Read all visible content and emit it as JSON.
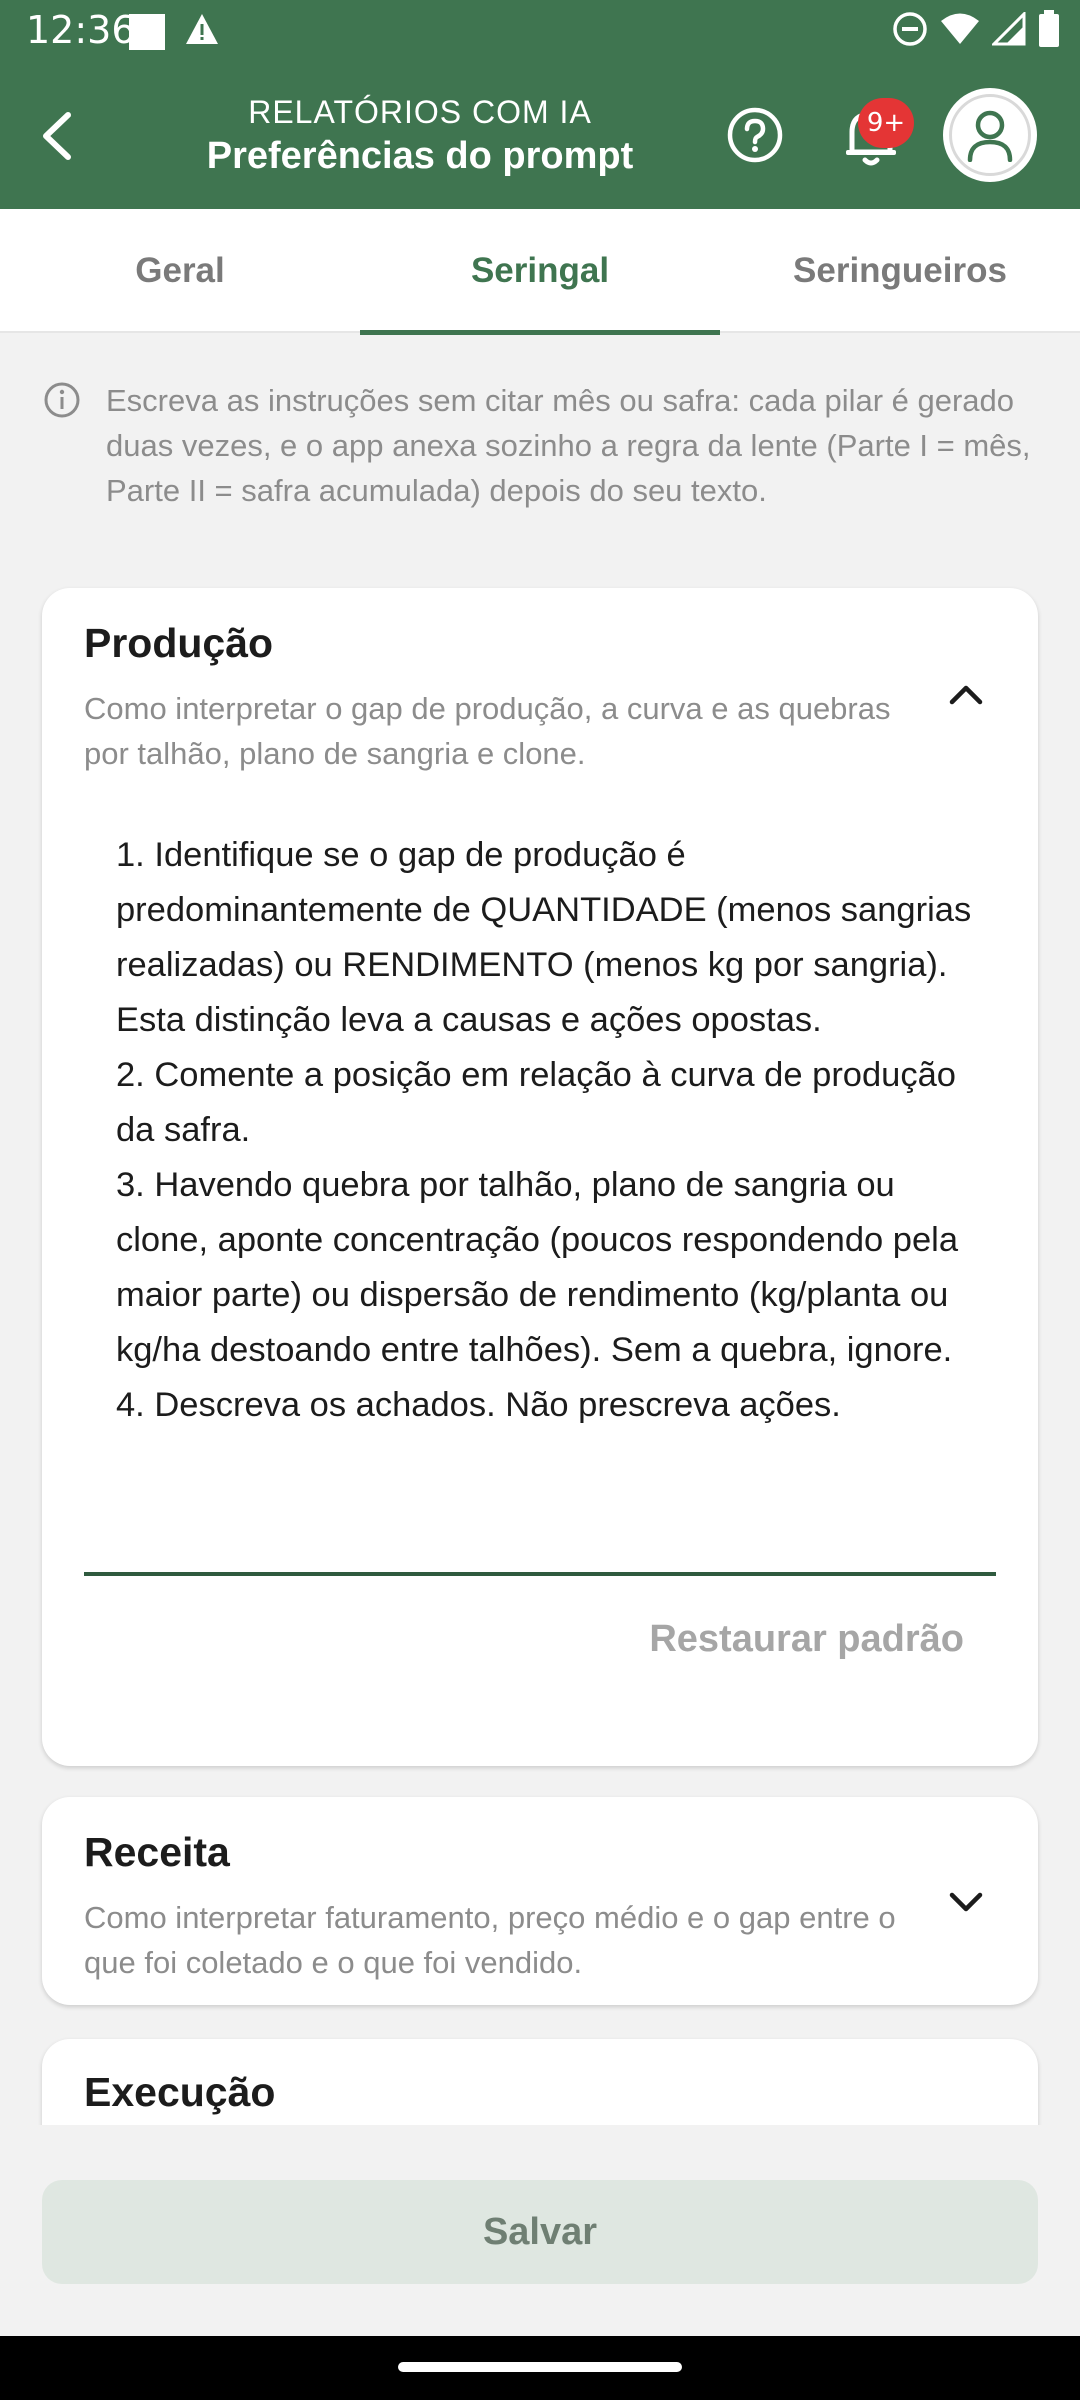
{
  "status": {
    "time": "12:36"
  },
  "header": {
    "overline": "RELATÓRIOS COM IA",
    "title": "Preferências do prompt",
    "notifications_badge": "9+"
  },
  "tabs": [
    {
      "label": "Geral",
      "active": false
    },
    {
      "label": "Seringal",
      "active": true
    },
    {
      "label": "Seringueiros",
      "active": false
    }
  ],
  "info": "Escreva as instruções sem citar mês ou safra: cada pilar é gerado duas vezes, e o app anexa sozinho a regra da lente (Parte I = mês, Parte II = safra acumulada) depois do seu texto.",
  "cards": {
    "producao": {
      "title": "Produção",
      "subtitle": "Como interpretar o gap de produção, a curva e as quebras por talhão, plano de sangria e clone.",
      "expanded": true,
      "prompt_lines": [
        "1. Identifique se o gap de produção é predominantemente de QUANTIDADE (menos sangrias realizadas) ou RENDIMENTO (menos kg por sangria). Esta distinção leva a causas e ações opostas.",
        "2. Comente a posição em relação à curva de produção da safra.",
        "3. Havendo quebra por talhão, plano de sangria ou clone, aponte concentração (poucos respondendo pela maior parte) ou dispersão de rendimento (kg/planta ou kg/ha destoando entre talhões). Sem a quebra, ignore.",
        "4. Descreva os achados. Não prescreva ações."
      ],
      "restore_label": "Restaurar padrão"
    },
    "receita": {
      "title": "Receita",
      "subtitle": "Como interpretar faturamento, preço médio e o gap entre o que foi coletado e o que foi vendido.",
      "expanded": false
    },
    "execucao": {
      "title": "Execução"
    }
  },
  "save_label": "Salvar",
  "colors": {
    "primary": "#3f7550",
    "badge": "#e43535",
    "muted_text": "#8c8c8c"
  }
}
